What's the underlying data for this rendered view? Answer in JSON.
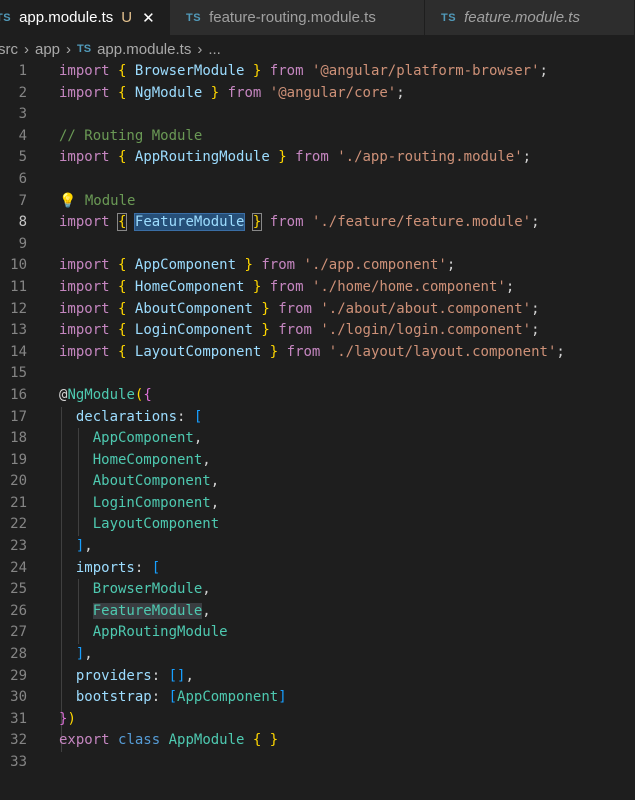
{
  "tabs": [
    {
      "icon": "TS",
      "name": "app.module.ts",
      "status": "U",
      "close": "✕"
    },
    {
      "icon": "TS",
      "name": "feature-routing.module.ts"
    },
    {
      "icon": "TS",
      "name": "feature.module.ts"
    }
  ],
  "breadcrumb": {
    "parts": [
      "src",
      "app"
    ],
    "file_icon": "TS",
    "file": "app.module.ts",
    "tail": "..."
  },
  "editor": {
    "active_line": 8,
    "line_numbers": [
      "1",
      "2",
      "3",
      "4",
      "5",
      "6",
      "7",
      "8",
      "9",
      "10",
      "11",
      "12",
      "13",
      "14",
      "15",
      "16",
      "17",
      "18",
      "19",
      "20",
      "21",
      "22",
      "23",
      "24",
      "25",
      "26",
      "27",
      "28",
      "29",
      "30",
      "31",
      "32",
      "33"
    ],
    "tokens": {
      "import": "import",
      "from": "from",
      "open": "{",
      "close": "}",
      "semi": ";",
      "comma": ",",
      "BrowserModule": "BrowserModule",
      "NgModule": "NgModule",
      "AppRoutingModule": "AppRoutingModule",
      "FeatureModule": "FeatureModule",
      "AppComponent": "AppComponent",
      "HomeComponent": "HomeComponent",
      "AboutComponent": "AboutComponent",
      "LoginComponent": "LoginComponent",
      "LayoutComponent": "LayoutComponent",
      "s1": "'@angular/platform-browser'",
      "s2": "'@angular/core'",
      "s5": "'./app-routing.module'",
      "s8": "'./feature/feature.module'",
      "s10": "'./app.component'",
      "s11": "'./home/home.component'",
      "s12": "'./about/about.component'",
      "s13": "'./login/login.component'",
      "s14": "'./layout/layout.component'",
      "c4": "// Routing Module",
      "c7": "Module",
      "at": "@",
      "paren_open": "(",
      "paren_close": ")",
      "declarations": "declarations",
      "imports": "imports",
      "providers": "providers",
      "bootstrap": "bootstrap",
      "colon": ":",
      "lbracket": "[",
      "rbracket": "]",
      "empty_arr": "[]",
      "export": "export",
      "class": "class",
      "AppModule": "AppModule"
    }
  },
  "icons": {
    "bulb": "lightbulb-icon",
    "close": "close-icon",
    "chevron": "chevron-right-icon"
  },
  "colors": {
    "background": "#1e1e1e",
    "keyword": "#c586c0",
    "string": "#ce9178",
    "variable": "#9cdcfe",
    "type": "#4ec9b0",
    "comment": "#6a9955"
  }
}
